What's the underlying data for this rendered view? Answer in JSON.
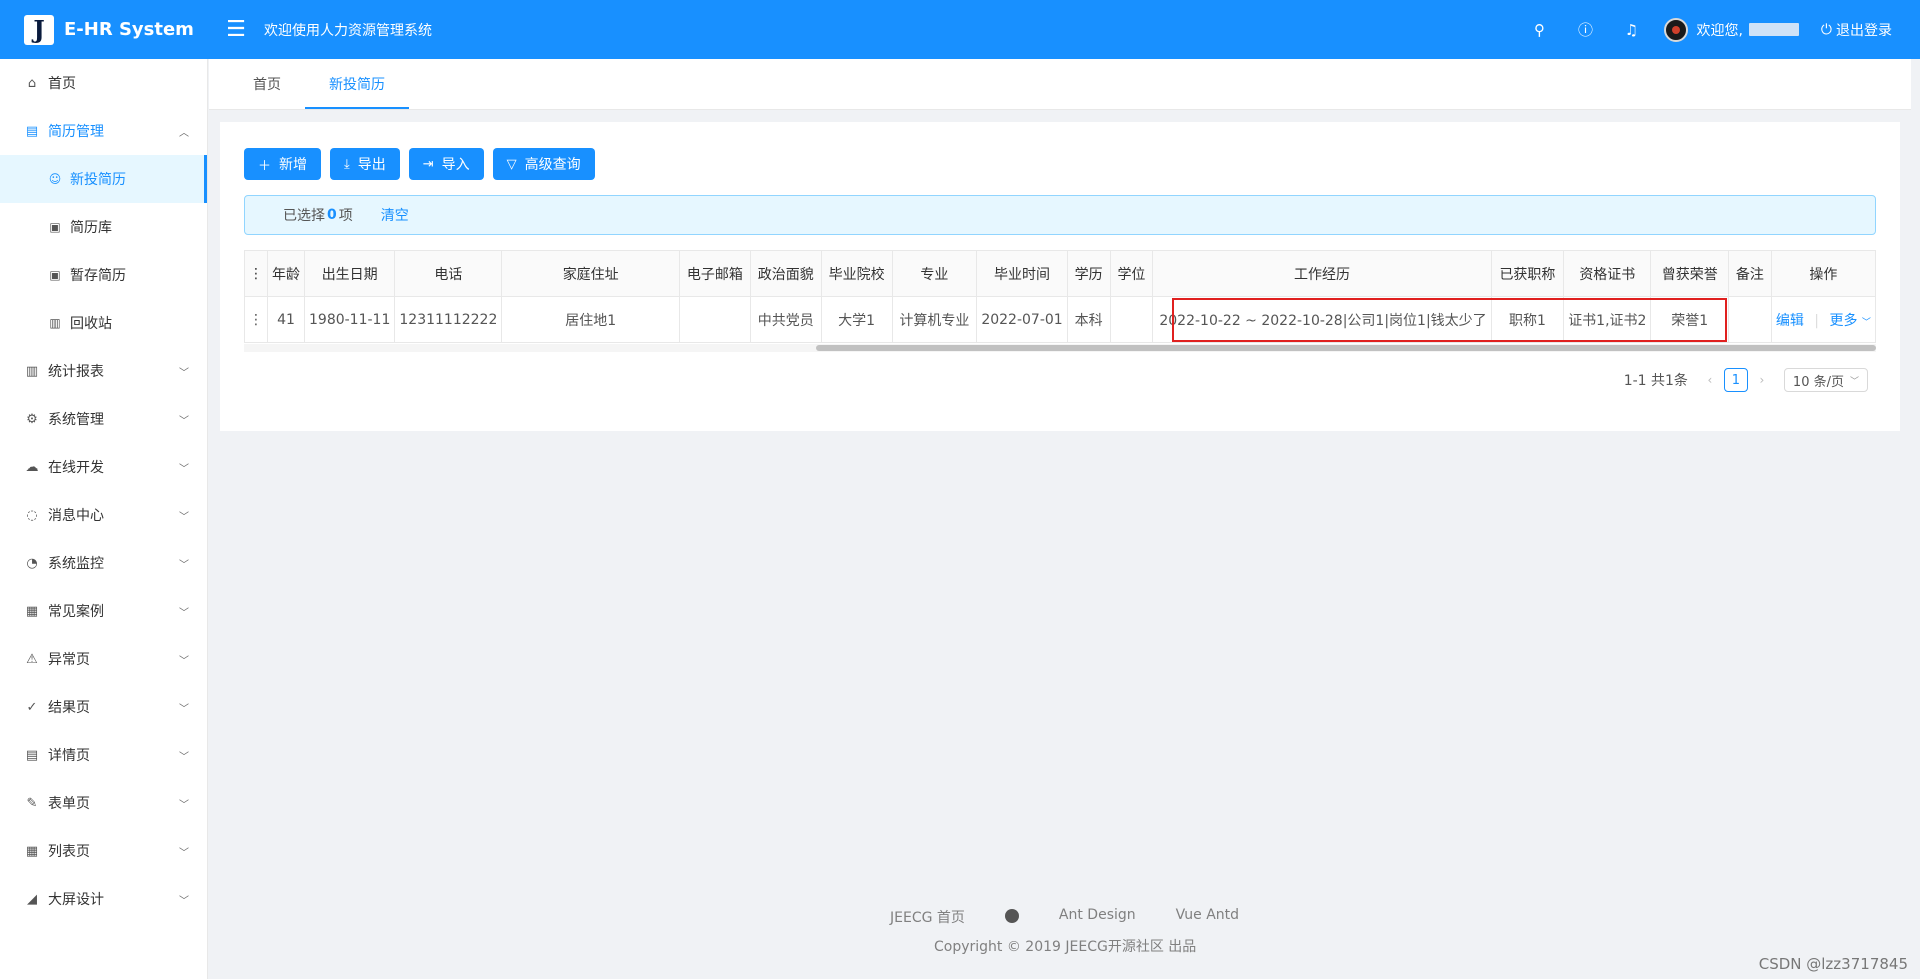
{
  "app": {
    "logo_letter": "J",
    "name": "E-HR System",
    "header_title": "欢迎使用人力资源管理系统",
    "welcome": "欢迎您,",
    "logout": "退出登录"
  },
  "sidebar": {
    "items": [
      {
        "label": "首页",
        "icon": "home-icon"
      },
      {
        "label": "简历管理",
        "icon": "resume-icon"
      },
      {
        "label": "统计报表",
        "icon": "bar-chart-icon"
      },
      {
        "label": "系统管理",
        "icon": "gear-icon"
      },
      {
        "label": "在线开发",
        "icon": "cloud-icon"
      },
      {
        "label": "消息中心",
        "icon": "message-icon"
      },
      {
        "label": "系统监控",
        "icon": "dashboard-icon"
      },
      {
        "label": "常见案例",
        "icon": "qrcode-icon"
      },
      {
        "label": "异常页",
        "icon": "warning-icon"
      },
      {
        "label": "结果页",
        "icon": "check-circle-icon"
      },
      {
        "label": "详情页",
        "icon": "profile-icon"
      },
      {
        "label": "表单页",
        "icon": "form-icon"
      },
      {
        "label": "列表页",
        "icon": "table-icon"
      },
      {
        "label": "大屏设计",
        "icon": "area-chart-icon"
      }
    ],
    "sub_items": [
      {
        "label": "新投简历",
        "icon": "user-icon"
      },
      {
        "label": "简历库",
        "icon": "save-icon"
      },
      {
        "label": "暂存简历",
        "icon": "save-icon"
      },
      {
        "label": "回收站",
        "icon": "delete-icon"
      }
    ]
  },
  "tabs": [
    {
      "label": "首页"
    },
    {
      "label": "新投简历"
    }
  ],
  "toolbar": {
    "add": "新增",
    "export": "导出",
    "import": "导入",
    "advanced_search": "高级查询"
  },
  "alert": {
    "prefix": "已选择",
    "count": "0",
    "suffix": "项",
    "clear": "清空"
  },
  "table": {
    "columns": [
      "年龄",
      "出生日期",
      "电话",
      "家庭住址",
      "电子邮箱",
      "政治面貌",
      "毕业院校",
      "专业",
      "毕业时间",
      "学历",
      "学位",
      "工作经历",
      "已获职称",
      "资格证书",
      "曾获荣誉",
      "备注",
      "操作"
    ],
    "rows": [
      {
        "age": "41",
        "birth": "1980-11-11",
        "phone": "12311112222",
        "address": "居住地1",
        "email": "",
        "political": "中共党员",
        "school": "大学1",
        "major": "计算机专业",
        "grad_time": "2022-07-01",
        "education": "本科",
        "degree": "",
        "work_exp": "2022-10-22 ~ 2022-10-28|公司1|岗位1|钱太少了",
        "title": "职称1",
        "certs": "证书1,证书2",
        "honors": "荣誉1",
        "remark": "",
        "edit": "编辑",
        "more": "更多"
      }
    ]
  },
  "pagination": {
    "total": "1-1 共1条",
    "page": "1",
    "size": "10 条/页"
  },
  "footer": {
    "link1": "JEECG 首页",
    "link2": "Ant Design",
    "link3": "Vue Antd",
    "copyright": "Copyright © 2019 JEECG开源社区 出品"
  },
  "watermark": "CSDN @lzz3717845",
  "colors": {
    "primary": "#1890ff",
    "highlight_box": "#e0201f"
  }
}
